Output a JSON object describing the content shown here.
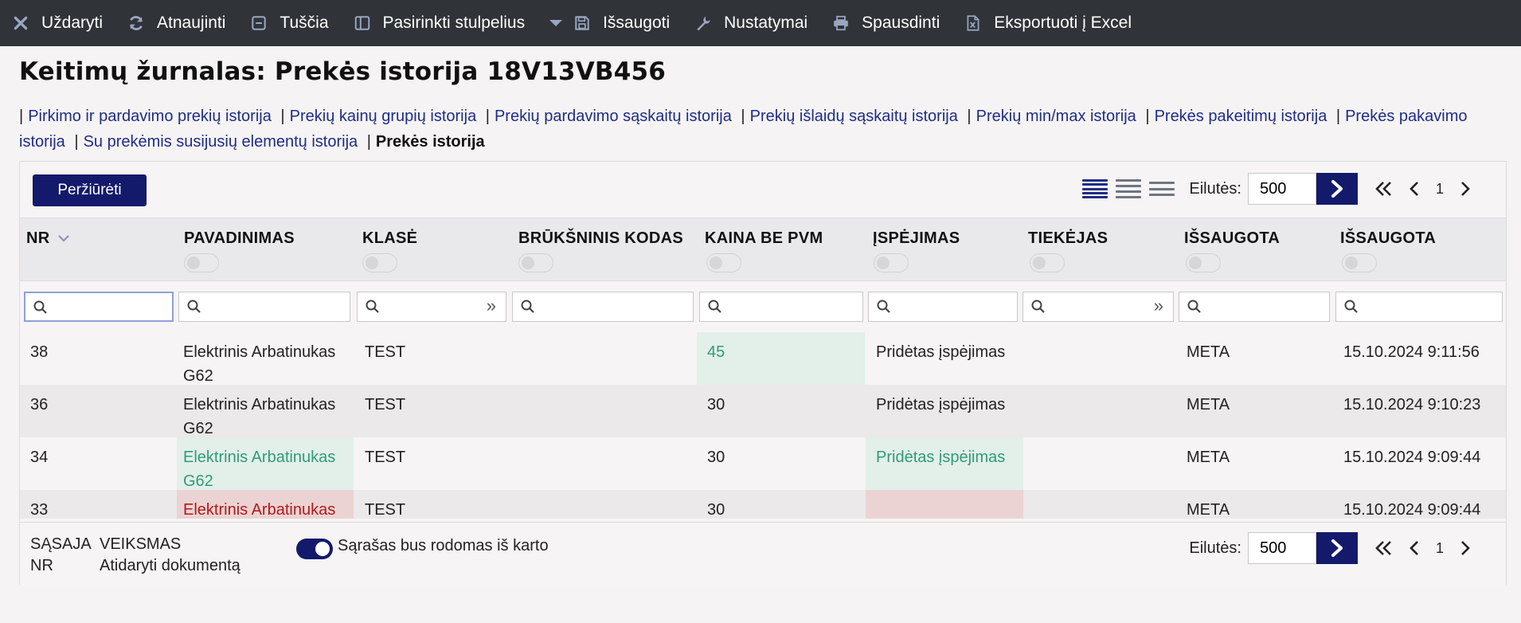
{
  "toolbar": {
    "close": "Uždaryti",
    "refresh": "Atnaujinti",
    "clear": "Tuščia",
    "choose_columns": "Pasirinkti stulpelius",
    "save": "Išsaugoti",
    "settings": "Nustatymai",
    "print": "Spausdinti",
    "export": "Eksportuoti į Excel"
  },
  "page_title": "Keitimų žurnalas: Prekės istorija 18V13VB456",
  "links": [
    "Pirkimo ir pardavimo prekių istorija",
    "Prekių kainų grupių istorija",
    "Prekių pardavimo sąskaitų istorija",
    "Prekių išlaidų sąskaitų istorija",
    "Prekių min/max istorija",
    "Prekės pakeitimų istorija",
    "Prekės pakavimo istorija",
    "Su prekėmis susijusių elementų istorija"
  ],
  "current_link": "Prekės istorija",
  "view_button": "Peržiūrėti",
  "pager": {
    "rows_label": "Eilutės:",
    "rows_value": "500",
    "page": "1"
  },
  "columns": [
    "NR",
    "PAVADINIMAS",
    "KLASĖ",
    "BRŪKŠNINIS KODAS",
    "KAINA BE PVM",
    "ĮSPĖJIMAS",
    "TIEKĖJAS",
    "IŠSAUGOTA",
    "IŠSAUGOTA"
  ],
  "rows": [
    {
      "nr": "38",
      "name": "Elektrinis Arbatinukas G62",
      "class": "TEST",
      "barcode": "",
      "price": "45",
      "warning": "Pridėtas įspėjimas",
      "supplier": "",
      "saved_by": "META",
      "saved_at": "15.10.2024 9:11:56"
    },
    {
      "nr": "36",
      "name": "Elektrinis Arbatinukas G62",
      "class": "TEST",
      "barcode": "",
      "price": "30",
      "warning": "Pridėtas įspėjimas",
      "supplier": "",
      "saved_by": "META",
      "saved_at": "15.10.2024 9:10:23"
    },
    {
      "nr": "34",
      "name": "Elektrinis Arbatinukas G62",
      "class": "TEST",
      "barcode": "",
      "price": "30",
      "warning": "Pridėtas įspėjimas",
      "supplier": "",
      "saved_by": "META",
      "saved_at": "15.10.2024 9:09:44"
    },
    {
      "nr": "33",
      "name": "Elektrinis Arbatinukas",
      "class": "TEST",
      "barcode": "",
      "price": "30",
      "warning": "",
      "supplier": "",
      "saved_by": "META",
      "saved_at": "15.10.2024 9:09:44"
    }
  ],
  "footer": {
    "legend_col1": [
      "SĄSAJA",
      "NR"
    ],
    "legend_col2": [
      "VEIKSMAS",
      "Atidaryti dokumentą"
    ],
    "switch_label": "Sąrašas bus rodomas iš karto"
  },
  "colors": {
    "toolbar_bg": "#303338",
    "primary": "#141a6b",
    "link": "#1f2d86",
    "added_green": "#2f9c78",
    "removed_red": "#b11a1a"
  }
}
